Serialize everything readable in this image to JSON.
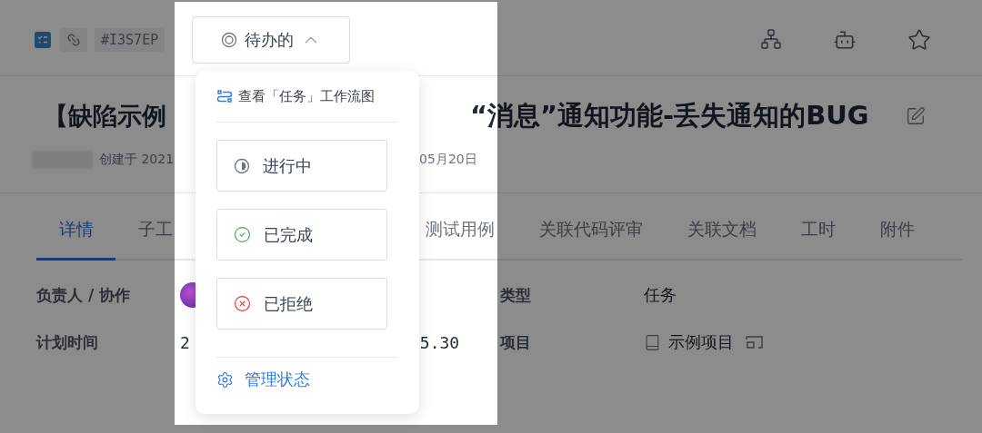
{
  "header": {
    "tag": "#I3S7EP",
    "status": {
      "label": "待办的",
      "expanded": true
    }
  },
  "title": {
    "left": "【缺陷示例",
    "right": "“消息”通知功能-丢失通知的BUG"
  },
  "meta": {
    "left": "创建于 2021",
    "right": "05月20日"
  },
  "tabs": [
    {
      "label": "详情",
      "selected": true
    },
    {
      "label": "子工",
      "selected": false
    },
    {
      "label": "测试用例",
      "selected": false
    },
    {
      "label": "关联代码评审",
      "selected": false
    },
    {
      "label": "关联文档",
      "selected": false
    },
    {
      "label": "工时",
      "selected": false
    },
    {
      "label": "附件",
      "selected": false
    }
  ],
  "rows": [
    {
      "label": "负责人 / 协作",
      "kind": "avatar",
      "side": {
        "label": "类型",
        "value": "任务",
        "kind": "text"
      }
    },
    {
      "label": "计划时间",
      "kind": "dates",
      "start": "2",
      "end": "5.30",
      "side": {
        "label": "项目",
        "value": "示例项目",
        "kind": "project"
      }
    }
  ],
  "status_menu": {
    "workflow_link": "查看「任务」工作流图",
    "options": [
      {
        "label": "进行中",
        "kind": "in-progress"
      },
      {
        "label": "已完成",
        "kind": "done"
      },
      {
        "label": "已拒绝",
        "kind": "rejected"
      }
    ],
    "manage": "管理状态"
  }
}
